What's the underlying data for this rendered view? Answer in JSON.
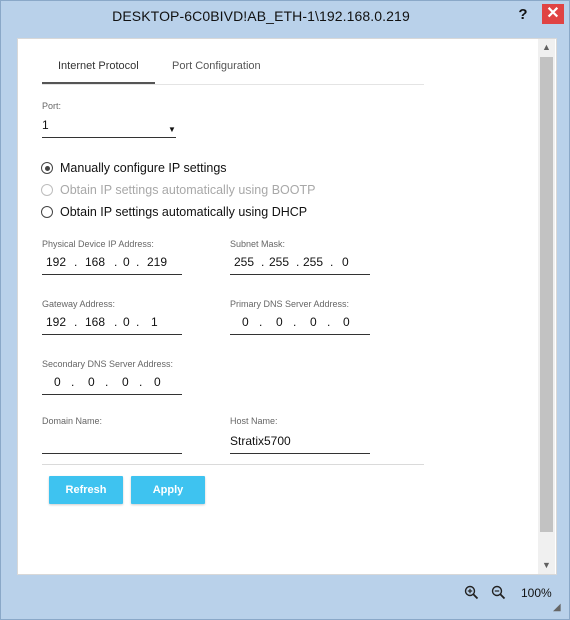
{
  "window": {
    "title": "DESKTOP-6C0BIVD!AB_ETH-1\\192.168.0.219",
    "help_label": "?",
    "close_label": "✕"
  },
  "tabs": {
    "internet_protocol": "Internet Protocol",
    "port_configuration": "Port Configuration",
    "active": "Internet Protocol"
  },
  "form": {
    "port_label": "Port:",
    "port_value": "1",
    "radio_manual": "Manually configure IP settings",
    "radio_bootp": "Obtain IP settings automatically using BOOTP",
    "radio_dhcp": "Obtain IP settings automatically using DHCP",
    "selected_radio": "Manually configure IP settings",
    "ip_label": "Physical Device IP Address:",
    "ip": [
      "192",
      "168",
      "0",
      "219"
    ],
    "mask_label": "Subnet Mask:",
    "mask": [
      "255",
      "255",
      "255",
      "0"
    ],
    "gateway_label": "Gateway Address:",
    "gateway": [
      "192",
      "168",
      "0",
      "1"
    ],
    "dns1_label": "Primary DNS Server Address:",
    "dns1": [
      "0",
      "0",
      "0",
      "0"
    ],
    "dns2_label": "Secondary DNS Server Address:",
    "dns2": [
      "0",
      "0",
      "0",
      "0"
    ],
    "domain_label": "Domain Name:",
    "domain_value": "",
    "host_label": "Host Name:",
    "host_value": "Stratix5700",
    "dot": "."
  },
  "buttons": {
    "refresh": "Refresh",
    "apply": "Apply"
  },
  "status": {
    "zoom_level": "100%"
  },
  "icons": {
    "zoom_in": "zoom-in-icon",
    "zoom_out": "zoom-out-icon",
    "close": "close-icon",
    "help": "help-icon",
    "dropdown": "chevron-down-icon"
  },
  "colors": {
    "accent_button": "#3ec3f0",
    "close_button": "#e04343",
    "window_frame": "#b9d1ea"
  }
}
